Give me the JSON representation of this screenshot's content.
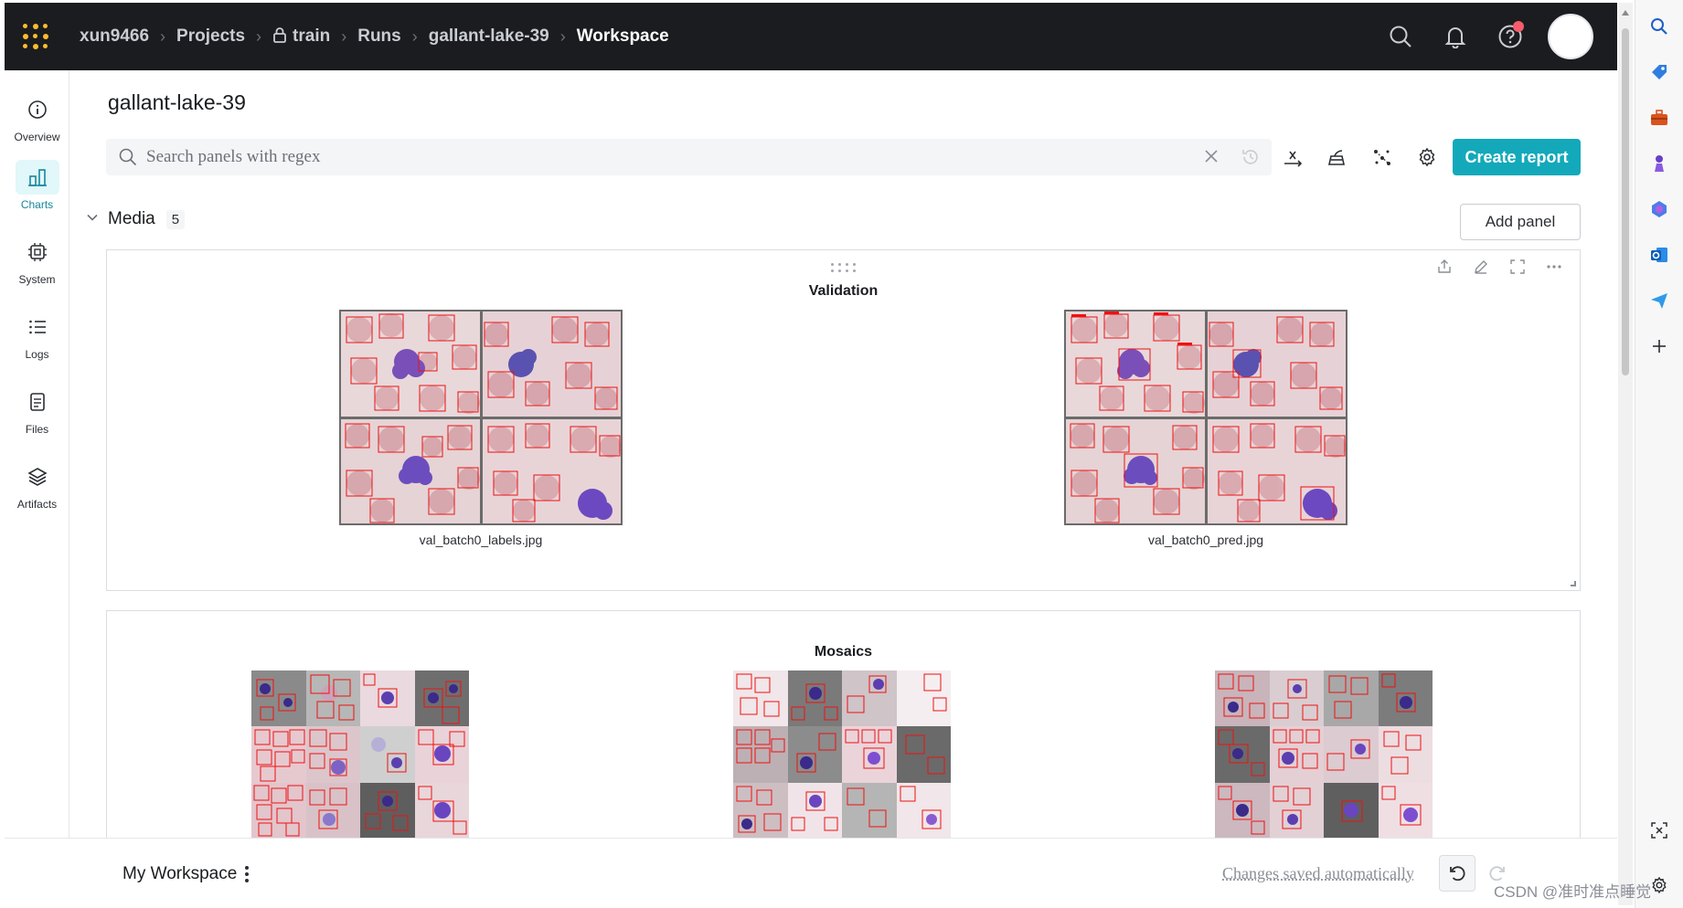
{
  "nav": {
    "breadcrumbs": [
      {
        "label": "xun9466"
      },
      {
        "label": "Projects"
      },
      {
        "label": "train",
        "icon": "lock-icon"
      },
      {
        "label": "Runs"
      },
      {
        "label": "gallant-lake-39"
      },
      {
        "label": "Workspace",
        "current": true
      }
    ],
    "icons": [
      "search-icon",
      "bell-icon",
      "help-icon",
      "avatar"
    ],
    "notification_dot_color": "#f55d6d"
  },
  "sidebar": {
    "items": [
      {
        "label": "Overview",
        "icon": "info-icon"
      },
      {
        "label": "Charts",
        "icon": "bar-chart-icon",
        "active": true
      },
      {
        "label": "System",
        "icon": "cpu-icon"
      },
      {
        "label": "Logs",
        "icon": "list-icon"
      },
      {
        "label": "Files",
        "icon": "file-icon"
      },
      {
        "label": "Artifacts",
        "icon": "layers-icon"
      }
    ]
  },
  "main": {
    "run_title": "gallant-lake-39",
    "search_placeholder": "Search panels with regex",
    "create_report_label": "Create report",
    "accent_color": "#13a9ba"
  },
  "section": {
    "title": "Media",
    "count": "5",
    "add_panel_label": "Add panel"
  },
  "panels": {
    "validation": {
      "title": "Validation",
      "images": [
        {
          "caption": "val_batch0_labels.jpg"
        },
        {
          "caption": "val_batch0_pred.jpg"
        }
      ]
    },
    "mosaics": {
      "title": "Mosaics"
    }
  },
  "footer": {
    "workspace_name": "My Workspace",
    "saved_status": "Changes saved automatically"
  },
  "watermark": "CSDN @准时准点睡觉"
}
